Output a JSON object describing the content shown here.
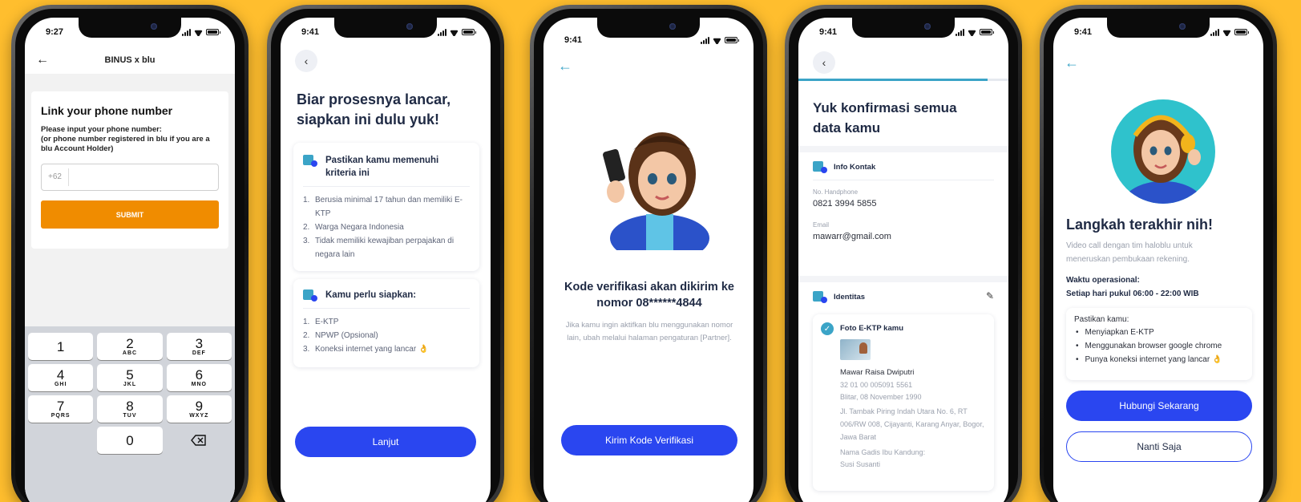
{
  "colors": {
    "background": "#FFBE2E",
    "primary_blue": "#2A46F0",
    "submit_orange": "#F08C00",
    "teal": "#3ba4c7"
  },
  "screen1": {
    "time": "9:27",
    "header_title": "BINUS x blu",
    "card_title": "Link your phone number",
    "instruction": "Please input your phone number:",
    "instruction_sub": "(or phone number registered in blu if you are a blu Account Holder)",
    "phone_prefix": "+62",
    "submit_label": "SUBMIT",
    "keypad": [
      [
        {
          "n": "1",
          "l": ""
        },
        {
          "n": "2",
          "l": "ABC"
        },
        {
          "n": "3",
          "l": "DEF"
        }
      ],
      [
        {
          "n": "4",
          "l": "GHI"
        },
        {
          "n": "5",
          "l": "JKL"
        },
        {
          "n": "6",
          "l": "MNO"
        }
      ],
      [
        {
          "n": "7",
          "l": "PQRS"
        },
        {
          "n": "8",
          "l": "TUV"
        },
        {
          "n": "9",
          "l": "WXYZ"
        }
      ]
    ],
    "key_zero": "0",
    "backspace_icon": "backspace-icon"
  },
  "screen2": {
    "time": "9:41",
    "title": "Biar prosesnya lancar, siapkan ini dulu yuk!",
    "section1_title": "Pastikan kamu memenuhi kriteria ini",
    "criteria": [
      "Berusia minimal 17 tahun dan memiliki E-KTP",
      "Warga Negara Indonesia",
      "Tidak memiliki kewajiban perpajakan di negara lain"
    ],
    "section2_title": "Kamu perlu siapkan:",
    "prep": [
      "E-KTP",
      "NPWP (Opsional)",
      "Koneksi internet yang lancar 👌"
    ],
    "button": "Lanjut"
  },
  "screen3": {
    "time": "9:41",
    "title": "Kode verifikasi akan dikirim ke nomor 08******4844",
    "desc": "Jika kamu ingin aktifkan blu menggunakan nomor lain, ubah melalui halaman pengaturan [Partner].",
    "button": "Kirim Kode Verifikasi"
  },
  "screen4": {
    "time": "9:41",
    "progress": 0.9,
    "title": "Yuk konfirmasi semua data kamu",
    "contact_title": "Info Kontak",
    "phone_label": "No. Handphone",
    "phone_value": "0821 3994 5855",
    "email_label": "Email",
    "email_value": "mawarr@gmail.com",
    "identity_title": "Identitas",
    "ktp_title": "Foto E-KTP kamu",
    "name": "Mawar Raisa Dwiputri",
    "nik": "32 01 00 005091 5561",
    "birth": "Blitar, 08 November 1990",
    "address": "Jl. Tambak Piring Indah Utara No. 6, RT 006/RW 008, Cijayanti, Karang Anyar, Bogor, Jawa Barat",
    "mother_label": "Nama Gadis Ibu Kandung:",
    "mother_value": "Susi Susanti"
  },
  "screen5": {
    "time": "9:41",
    "title": "Langkah terakhir nih!",
    "desc": "Video call dengan tim haloblu untuk meneruskan pembukaan rekening.",
    "hours_label": "Waktu operasional:",
    "hours_value": "Setiap hari pukul 06:00 - 22:00 WIB",
    "ensure_label": "Pastikan kamu:",
    "ensure_items": [
      "Menyiapkan E-KTP",
      "Menggunakan browser google chrome",
      "Punya koneksi internet yang lancar 👌"
    ],
    "primary_button": "Hubungi Sekarang",
    "secondary_button": "Nanti Saja"
  }
}
